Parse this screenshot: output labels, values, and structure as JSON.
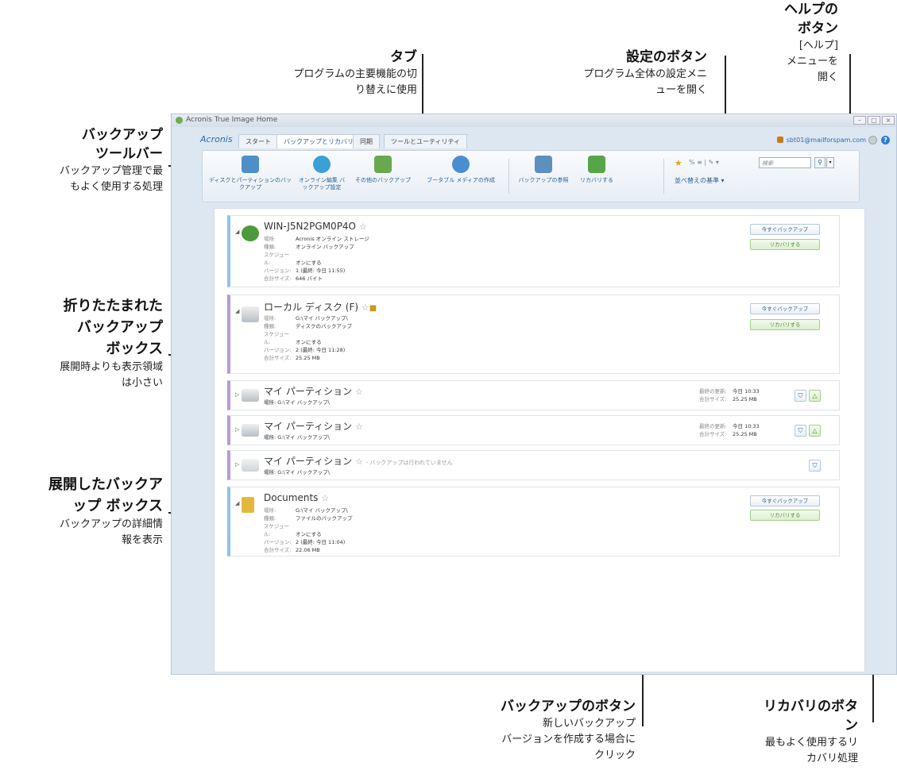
{
  "annotations": {
    "tabs": {
      "title": "タブ",
      "desc": [
        "プログラムの主要機能の切",
        "り替えに使用"
      ]
    },
    "settings": {
      "title": "設定のボタン",
      "desc": [
        "プログラム全体の設定メニ",
        "ューを開く"
      ]
    },
    "help": {
      "title": [
        "ヘルプの",
        "ボタン"
      ],
      "desc": [
        "[ヘルプ]",
        "メニューを",
        "開く"
      ]
    },
    "toolbar": {
      "title": [
        "バックアップ",
        "ツールバー"
      ],
      "desc": [
        "バックアップ管理で最",
        "もよく使用する処理"
      ]
    },
    "collapsed": {
      "title": [
        "折りたたまれた",
        "バックアップ",
        "ボックス"
      ],
      "desc": [
        "展開時よりも表示領域",
        "は小さい"
      ]
    },
    "expanded": {
      "title": [
        "展開したバックア",
        "ップ ボックス"
      ],
      "desc": [
        "バックアップの詳細情",
        "報を表示"
      ]
    },
    "backup_btn": {
      "title": "バックアップのボタン",
      "desc": [
        "新しいバックアップ",
        "バージョンを作成する場合に",
        "クリック"
      ]
    },
    "recovery_btn": {
      "title": [
        "リカバリのボタ",
        "ン"
      ],
      "desc": [
        "最もよく使用するリ",
        "カバリ処理"
      ]
    }
  },
  "window": {
    "title": "Acronis True Image Home",
    "brand": "Acronis",
    "tabs": [
      "スタート",
      "バックアップとリカバリ",
      "同期",
      "ツールとユーティリティ"
    ],
    "user": "sbt01@mailforspam.com"
  },
  "toolbar": {
    "items": [
      {
        "label": "ディスクとパーティションのバックアップ",
        "icon": "disk-backup-icon",
        "color": "#4d8fc9"
      },
      {
        "label": "オンライン編集 バックアップ設定",
        "icon": "online-backup-icon",
        "color": "#3aa0d6"
      },
      {
        "label": "その他のバックアップ",
        "icon": "other-backup-icon",
        "color": "#6aa84f"
      },
      {
        "label": "ブータブル メディアの作成",
        "icon": "bootable-media-icon",
        "color": "#4a8ed1"
      },
      {
        "label": "バックアップの参照",
        "icon": "browse-backup-icon",
        "color": "#5d8fbf"
      },
      {
        "label": "リカバリする",
        "icon": "recover-icon",
        "color": "#58a548"
      }
    ],
    "misc": "% ≡ | ✎ ▾",
    "sort_label": "並べ替えの基準 ▾",
    "search_placeholder": "検索"
  },
  "boxes": [
    {
      "title": "WIN-J5N2PGM0P4O",
      "details": [
        {
          "k": "場所:",
          "v": "Acronis オンライン ストレージ"
        },
        {
          "k": "種類:",
          "v": "オンライン バックアップ"
        },
        {
          "k": "スケジュール:",
          "v": "オンにする"
        },
        {
          "k": "バージョン:",
          "v": "1 (最終: 今日 11:55)"
        },
        {
          "k": "合計サイズ:",
          "v": "646 バイト"
        }
      ],
      "backup_label": "今すぐバックアップ",
      "recover_label": "リカバリする"
    },
    {
      "title": "ローカル ディスク (F)",
      "details": [
        {
          "k": "場所:",
          "v": "G:\\マイ バックアップ\\"
        },
        {
          "k": "種類:",
          "v": "ディスクのバックアップ"
        },
        {
          "k": "スケジュール:",
          "v": "オンにする"
        },
        {
          "k": "バージョン:",
          "v": "2 (最終: 今日 11:28)"
        },
        {
          "k": "合計サイズ:",
          "v": "25.25 MB"
        }
      ],
      "backup_label": "今すぐバックアップ",
      "recover_label": "リカバリする"
    },
    {
      "title": "マイ パーティション",
      "location": "場所: G:\\マイ バックアップ\\",
      "meta": [
        {
          "k": "最終の更新:",
          "v": "今日 10:33"
        },
        {
          "k": "合計サイズ:",
          "v": "25.25 MB"
        }
      ]
    },
    {
      "title": "マイ パーティション",
      "location": "場所: G:\\マイ バックアップ\\",
      "meta": [
        {
          "k": "最終の更新:",
          "v": "今日 10:33"
        },
        {
          "k": "合計サイズ:",
          "v": "25.25 MB"
        }
      ]
    },
    {
      "title": "マイ パーティション",
      "note": "- バックアップは行われていません",
      "location": "場所: G:\\マイ バックアップ\\"
    },
    {
      "title": "Documents",
      "details": [
        {
          "k": "場所:",
          "v": "G:\\マイ バックアップ\\"
        },
        {
          "k": "種類:",
          "v": "ファイルのバックアップ"
        },
        {
          "k": "スケジュール:",
          "v": "オンにする"
        },
        {
          "k": "バージョン:",
          "v": "2 (最終: 今日 11:04)"
        },
        {
          "k": "合計サイズ:",
          "v": "22.06 MB"
        }
      ],
      "backup_label": "今すぐバックアップ",
      "recover_label": "リカバリする"
    }
  ]
}
